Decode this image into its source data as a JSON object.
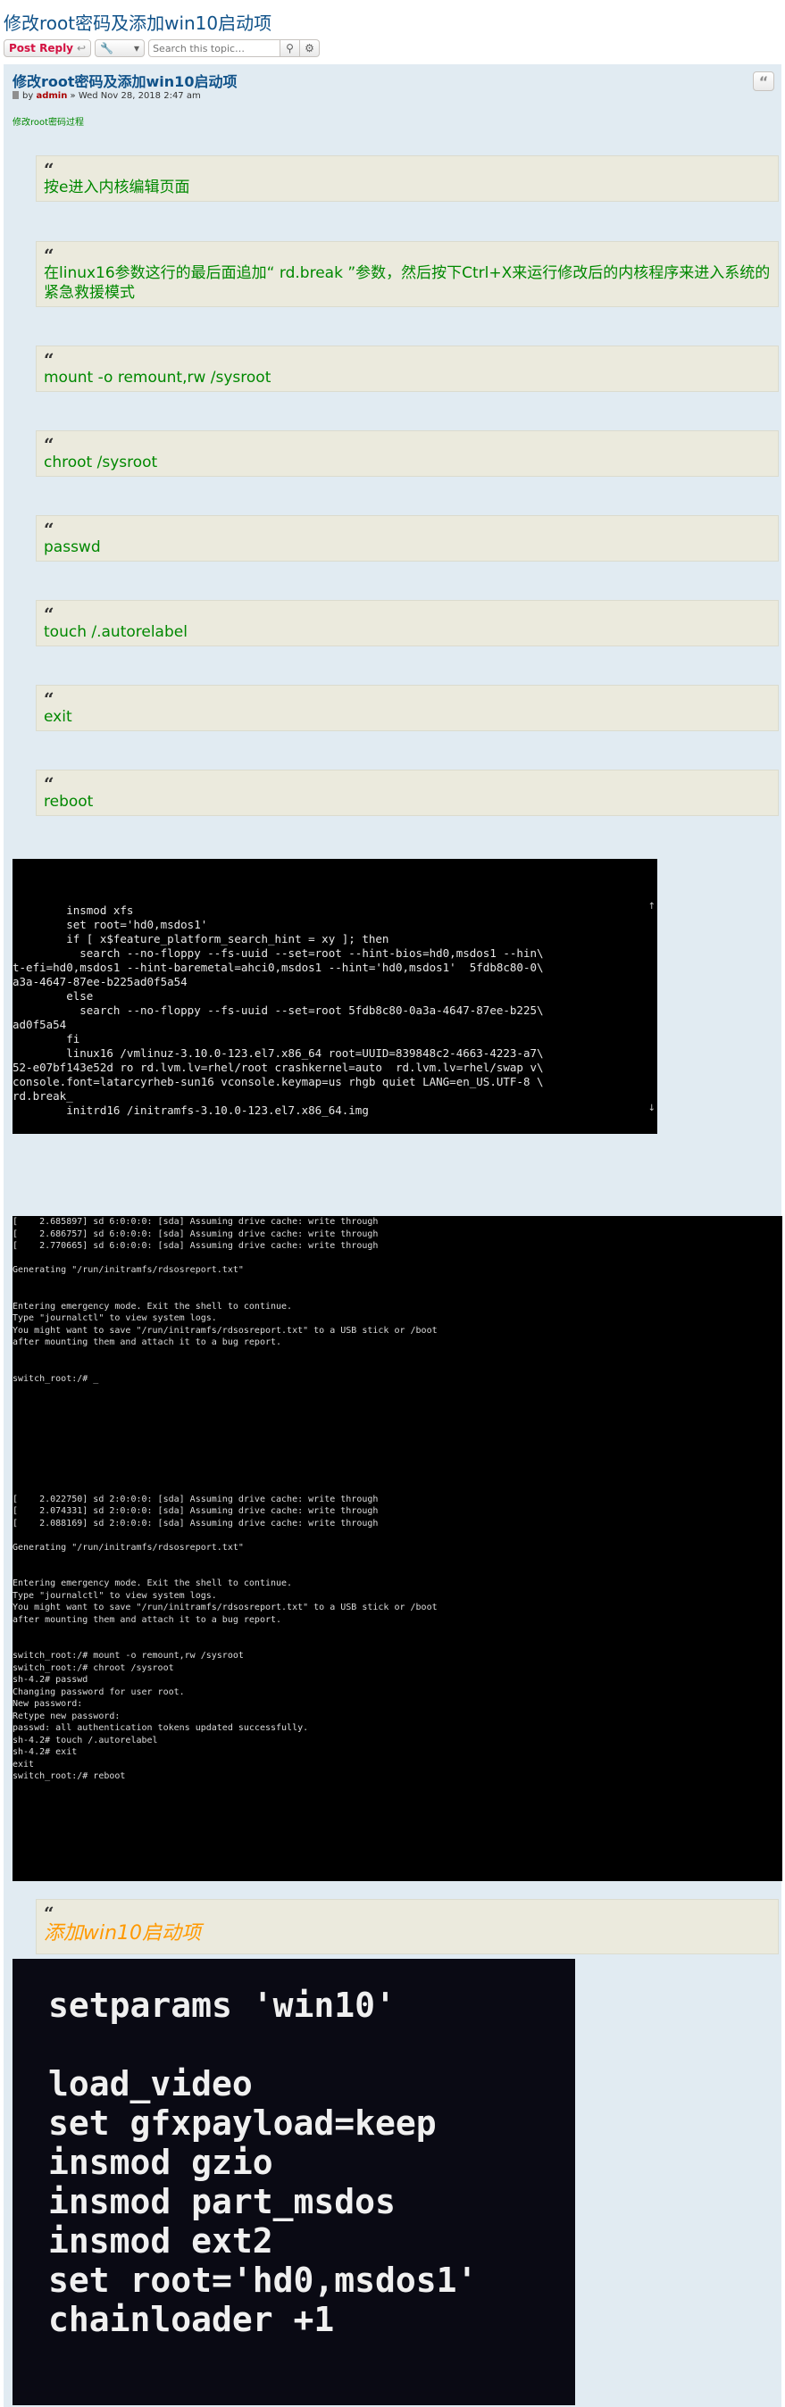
{
  "topic_title": "修改root密码及添加win10启动项",
  "action_bar": {
    "post_reply_label": "Post Reply",
    "reply_icon": "reply-arrow-icon",
    "tools_icon": "wrench-icon",
    "search_placeholder": "Search this topic…",
    "search_icon": "magnifier-icon",
    "advanced_icon": "gear-icon"
  },
  "post": {
    "title": "修改root密码及添加win10启动项",
    "by_label": "by",
    "author": "admin",
    "separator": "»",
    "date": "Wed Nov 28, 2018 2:47 am",
    "subtitle": "修改root密码过程",
    "quote_button_icon": "quote-icon",
    "quotes": [
      "按e进入内核编辑页面",
      "在linux16参数这行的最后面追加“ rd.break ”参数，然后按下Ctrl+X来运行修改后的内核程序来进入系统的紧急救援模式",
      "mount -o remount,rw /sysroot",
      "chroot /sysroot",
      "passwd",
      "touch /.autorelabel",
      "exit",
      "reboot"
    ],
    "win10_quote": "添加win10启动项",
    "quote_mark": "“"
  },
  "screenshot1_text": "        insmod xfs\n        set root='hd0,msdos1'\n        if [ x$feature_platform_search_hint = xy ]; then\n          search --no-floppy --fs-uuid --set=root --hint-bios=hd0,msdos1 --hin\\\nt-efi=hd0,msdos1 --hint-baremetal=ahci0,msdos1 --hint='hd0,msdos1'  5fdb8c80-0\\\na3a-4647-87ee-b225ad0f5a54\n        else\n          search --no-floppy --fs-uuid --set=root 5fdb8c80-0a3a-4647-87ee-b225\\\nad0f5a54\n        fi\n        linux16 /vmlinuz-3.10.0-123.el7.x86_64 root=UUID=839848c2-4663-4223-a7\\\n52-e07bf143e52d ro rd.lvm.lv=rhel/root crashkernel=auto  rd.lvm.lv=rhel/swap v\\\nconsole.font=latarcyrheb-sun16 vconsole.keymap=us rhgb quiet LANG=en_US.UTF-8 \\\nrd.break_\n        initrd16 /initramfs-3.10.0-123.el7.x86_64.img\n\n      Press Ctrl-x to start, Ctrl-c for a command prompt or Escape to\n      discard edits and return to the menu. Pressing Tab lists\n      possible completions.",
  "screenshot2_text": "[    2.685897] sd 6:0:0:0: [sda] Assuming drive cache: write through\n[    2.686757] sd 6:0:0:0: [sda] Assuming drive cache: write through\n[    2.770665] sd 6:0:0:0: [sda] Assuming drive cache: write through\n\nGenerating \"/run/initramfs/rdsosreport.txt\"\n\n\nEntering emergency mode. Exit the shell to continue.\nType \"journalctl\" to view system logs.\nYou might want to save \"/run/initramfs/rdsosreport.txt\" to a USB stick or /boot\nafter mounting them and attach it to a bug report.\n\n\nswitch_root:/# _\n\n\n\n\n\n\n\n\n\n[    2.022750] sd 2:0:0:0: [sda] Assuming drive cache: write through\n[    2.074331] sd 2:0:0:0: [sda] Assuming drive cache: write through\n[    2.088169] sd 2:0:0:0: [sda] Assuming drive cache: write through\n\nGenerating \"/run/initramfs/rdsosreport.txt\"\n\n\nEntering emergency mode. Exit the shell to continue.\nType \"journalctl\" to view system logs.\nYou might want to save \"/run/initramfs/rdsosreport.txt\" to a USB stick or /boot\nafter mounting them and attach it to a bug report.\n\n\nswitch_root:/# mount -o remount,rw /sysroot\nswitch_root:/# chroot /sysroot\nsh-4.2# passwd\nChanging password for user root.\nNew password:\nRetype new password:\npasswd: all authentication tokens updated successfully.\nsh-4.2# touch /.autorelabel\nsh-4.2# exit\nexit\nswitch_root:/# reboot",
  "screenshot3_text": "setparams 'win10'\n\nload_video\nset gfxpayload=keep\ninsmod gzio\ninsmod part_msdos\ninsmod ext2\nset root='hd0,msdos1'\nchainloader +1",
  "colors": {
    "link_blue": "#105289",
    "post_bg": "#e1ebf2",
    "quote_bg": "#ebeadd",
    "green_text": "#008800",
    "orange_text": "#ff9900",
    "author_red": "#aa0000",
    "reply_red": "#d31141"
  }
}
